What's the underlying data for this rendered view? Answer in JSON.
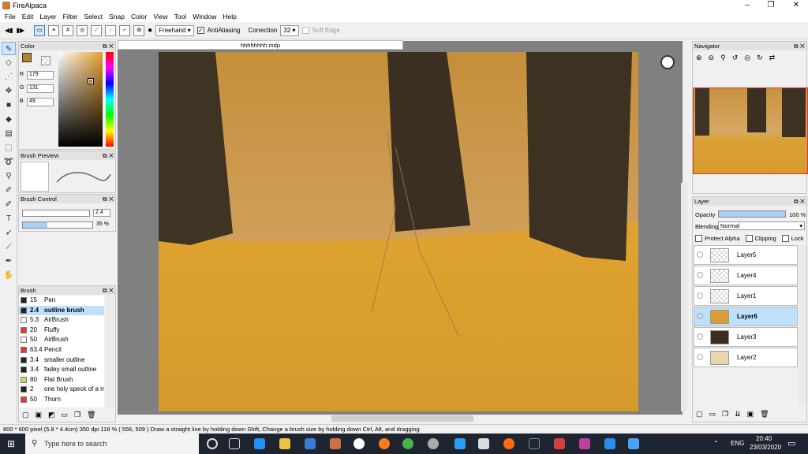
{
  "window": {
    "title": "FireAlpaca"
  },
  "menu": [
    "File",
    "Edit",
    "Layer",
    "Filter",
    "Select",
    "Snap",
    "Color",
    "View",
    "Tool",
    "Window",
    "Help"
  ],
  "toolbar": {
    "mode": "Freehand",
    "antialiasing_label": "AntiAliasing",
    "correction_label": "Correction",
    "correction_value": "32",
    "soft_edge_label": "Soft Edge"
  },
  "canvas": {
    "tab_title": "hhhhhhhh.mdp"
  },
  "color_panel": {
    "title": "Color",
    "r": "179",
    "g": "131",
    "b": "49",
    "current": "#b38331"
  },
  "brush_preview": {
    "title": "Brush Preview"
  },
  "brush_control": {
    "title": "Brush Control",
    "size": "2.4",
    "opacity": "35 %",
    "opacity_fraction": 0.35
  },
  "brush_panel": {
    "title": "Brush",
    "items": [
      {
        "size": "15",
        "name": "Pen",
        "color": "#222222"
      },
      {
        "size": "2.4",
        "name": "outline brush",
        "color": "#222222"
      },
      {
        "size": "5.3",
        "name": "AirBrush",
        "color": "#ffffff"
      },
      {
        "size": "20",
        "name": "Fluffy",
        "color": "#e03a3a"
      },
      {
        "size": "50",
        "name": "AirBrush",
        "color": "#ffffff"
      },
      {
        "size": "63.4",
        "name": "Pencil",
        "color": "#e03a3a"
      },
      {
        "size": "3.4",
        "name": "smaller outline",
        "color": "#222222"
      },
      {
        "size": "3.4",
        "name": "fadey small outline",
        "color": "#222222"
      },
      {
        "size": "80",
        "name": "Flat Brush",
        "color": "#b8e06a"
      },
      {
        "size": "2",
        "name": "one holy speck of a m",
        "color": "#222222"
      },
      {
        "size": "50",
        "name": "Thorn",
        "color": "#e03a3a"
      }
    ]
  },
  "navigator": {
    "title": "Navigator"
  },
  "layer_panel": {
    "title": "Layer",
    "opacity_label": "Opacity",
    "opacity_value": "100 %",
    "blending_label": "Blending",
    "blending_value": "Normal",
    "protect_alpha": "Protect Alpha",
    "clipping": "Clipping",
    "lock": "Lock",
    "layers": [
      "Layer5",
      "Layer4",
      "Layer1",
      "Layer6",
      "Layer3",
      "Layer2"
    ]
  },
  "status": {
    "text": "800 * 600 pixel  (5.8 * 4.4cm)  350 dpi  118 %  ( 556, 509 )  Draw a straight line by holding down Shift, Change a brush size by holding down Ctrl, Alt, and dragging"
  },
  "taskbar": {
    "search": "Type here to search",
    "lang": "ENG",
    "time": "20:40",
    "date": "23/03/2020"
  }
}
